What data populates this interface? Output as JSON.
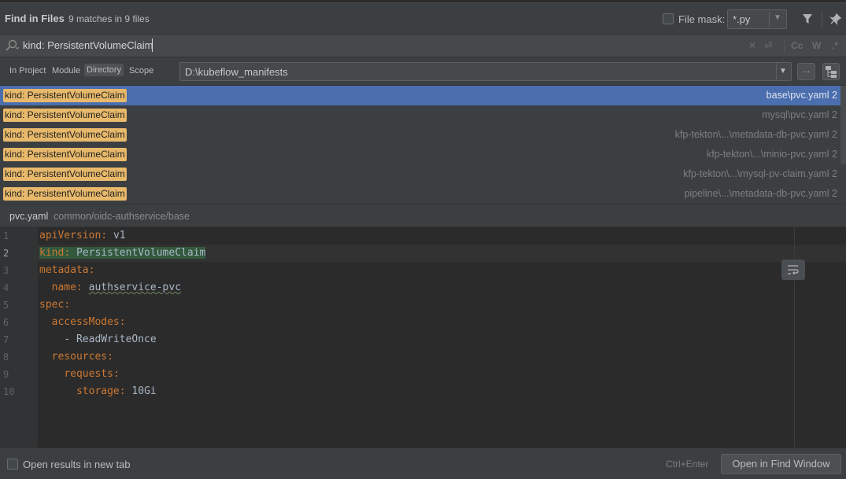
{
  "header": {
    "title": "Find in Files",
    "match_count": "9 matches in 9 files",
    "file_mask_label": "File mask:",
    "file_mask_value": "*.py",
    "filter_icon": "filter-icon",
    "pin_icon": "pin-icon"
  },
  "search": {
    "query": "kind: PersistentVolumeClaim",
    "options": [
      "Cc",
      "W",
      ".*"
    ]
  },
  "scope": {
    "options": [
      "In Project",
      "Module",
      "Directory",
      "Scope"
    ],
    "selected": "Directory",
    "directory": "D:\\kubeflow_manifests",
    "browse_label": "..."
  },
  "results": [
    {
      "match": "kind: PersistentVolumeClaim",
      "path": "base\\pvc.yaml 2",
      "selected": true
    },
    {
      "match": "kind: PersistentVolumeClaim",
      "path": "mysql\\pvc.yaml 2"
    },
    {
      "match": "kind: PersistentVolumeClaim",
      "path": "kfp-tekton\\...\\metadata-db-pvc.yaml 2"
    },
    {
      "match": "kind: PersistentVolumeClaim",
      "path": "kfp-tekton\\...\\minio-pvc.yaml 2"
    },
    {
      "match": "kind: PersistentVolumeClaim",
      "path": "kfp-tekton\\...\\mysql-pv-claim.yaml 2"
    },
    {
      "match": "kind: PersistentVolumeClaim",
      "path": "pipeline\\...\\metadata-db-pvc.yaml 2"
    }
  ],
  "preview": {
    "file_name": "pvc.yaml",
    "file_path": "common/oidc-authservice/base",
    "lines": [
      {
        "n": "1",
        "key": "apiVersion",
        "value": "v1",
        "indent": ""
      },
      {
        "n": "2",
        "key": "kind",
        "value": "PersistentVolumeClaim",
        "indent": ""
      },
      {
        "n": "3",
        "key": "metadata",
        "value": "",
        "indent": ""
      },
      {
        "n": "4",
        "key": "name",
        "value": "authservice-pvc",
        "indent": "  "
      },
      {
        "n": "5",
        "key": "spec",
        "value": "",
        "indent": ""
      },
      {
        "n": "6",
        "key": "accessModes",
        "value": "",
        "indent": "  "
      },
      {
        "n": "7",
        "key": "",
        "value": "- ReadWriteOnce",
        "indent": "    "
      },
      {
        "n": "8",
        "key": "resources",
        "value": "",
        "indent": "  "
      },
      {
        "n": "9",
        "key": "requests",
        "value": "",
        "indent": "    "
      },
      {
        "n": "10",
        "key": "storage",
        "value": "10Gi",
        "indent": "      "
      }
    ]
  },
  "footer": {
    "open_new_tab_label": "Open results in new tab",
    "shortcut_hint": "Ctrl+Enter",
    "open_button": "Open in Find Window"
  }
}
